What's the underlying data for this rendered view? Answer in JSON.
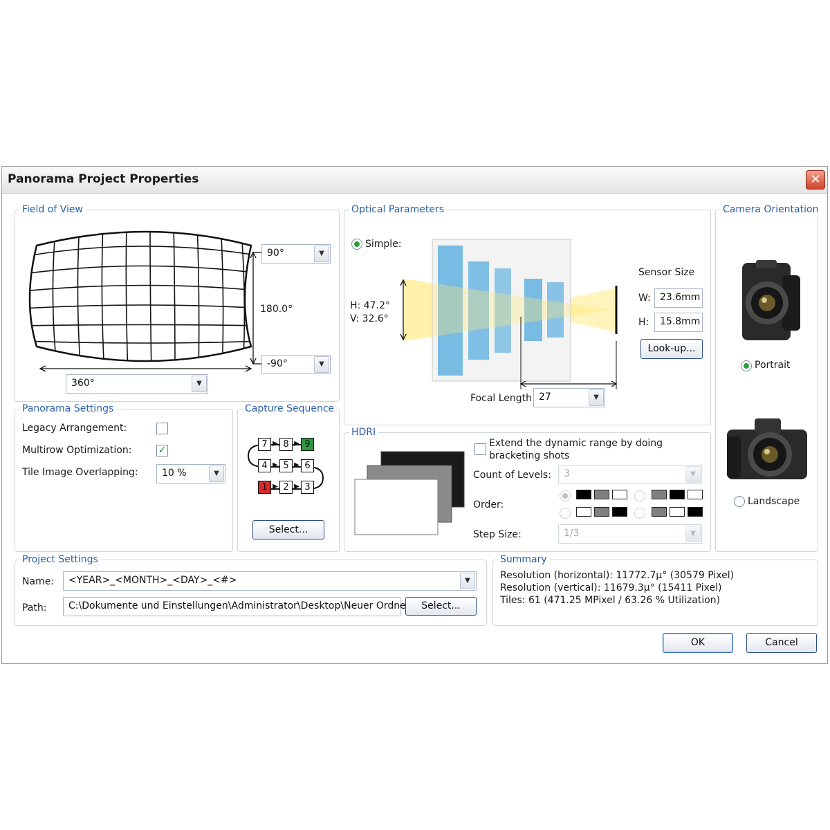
{
  "window": {
    "title": "Panorama Project Properties",
    "close_glyph": "✕"
  },
  "field_of_view": {
    "title": "Field of View",
    "top_value": "90°",
    "bottom_value": "-90°",
    "vertical_span": "180.0°",
    "horizontal_value": "360°"
  },
  "optical": {
    "title": "Optical Parameters",
    "mode_label": "Simple:",
    "angle_h": "H: 47.2°",
    "angle_v": "V: 32.6°",
    "sensor_size_label": "Sensor Size",
    "w_label": "W:",
    "w_value": "23.6mm",
    "h_label": "H:",
    "h_value": "15.8mm",
    "lookup_button": "Look-up...",
    "focal_length_label": "Focal Length",
    "focal_length_value": "27"
  },
  "camera_orientation": {
    "title": "Camera Orientation",
    "portrait_label": "Portrait",
    "landscape_label": "Landscape",
    "selected": "Portrait"
  },
  "panorama_settings": {
    "title": "Panorama Settings",
    "legacy_label": "Legacy Arrangement:",
    "legacy_checked": false,
    "multirow_label": "Multirow Optimization:",
    "multirow_checked": true,
    "overlap_label": "Tile Image Overlapping:",
    "overlap_value": "10 %"
  },
  "capture_sequence": {
    "title": "Capture Sequence",
    "rows": [
      [
        "7",
        "8",
        "9"
      ],
      [
        "4",
        "5",
        "6"
      ],
      [
        "1",
        "2",
        "3"
      ]
    ],
    "start_cell": "1",
    "end_cell": "9",
    "select_button": "Select..."
  },
  "hdri": {
    "title": "HDRI",
    "extend_label_line1": "Extend the dynamic range by doing",
    "extend_label_line2": "bracketing shots",
    "extend_checked": false,
    "count_label": "Count of Levels:",
    "count_value": "3",
    "order_label": "Order:",
    "step_label": "Step Size:",
    "step_value": "1/3"
  },
  "project_settings": {
    "title": "Project Settings",
    "name_label": "Name:",
    "name_value": "<YEAR>_<MONTH>_<DAY>_<#>",
    "path_label": "Path:",
    "path_value": "C:\\Dokumente und Einstellungen\\Administrator\\Desktop\\Neuer Ordner",
    "select_button": "Select..."
  },
  "summary": {
    "title": "Summary",
    "line1": "Resolution (horizontal): 11772.7µ° (30579 Pixel)",
    "line2": "Resolution (vertical): 11679.3µ° (15411 Pixel)",
    "line3": "Tiles: 61 (471.25 MPixel  / 63.26 % Utilization)"
  },
  "buttons": {
    "ok": "OK",
    "cancel": "Cancel"
  },
  "colors": {
    "group_title": "#2b5fa6",
    "start_cell": "#d62b2b",
    "end_cell": "#2f9a45",
    "radio_dot": "#2aa03a"
  }
}
